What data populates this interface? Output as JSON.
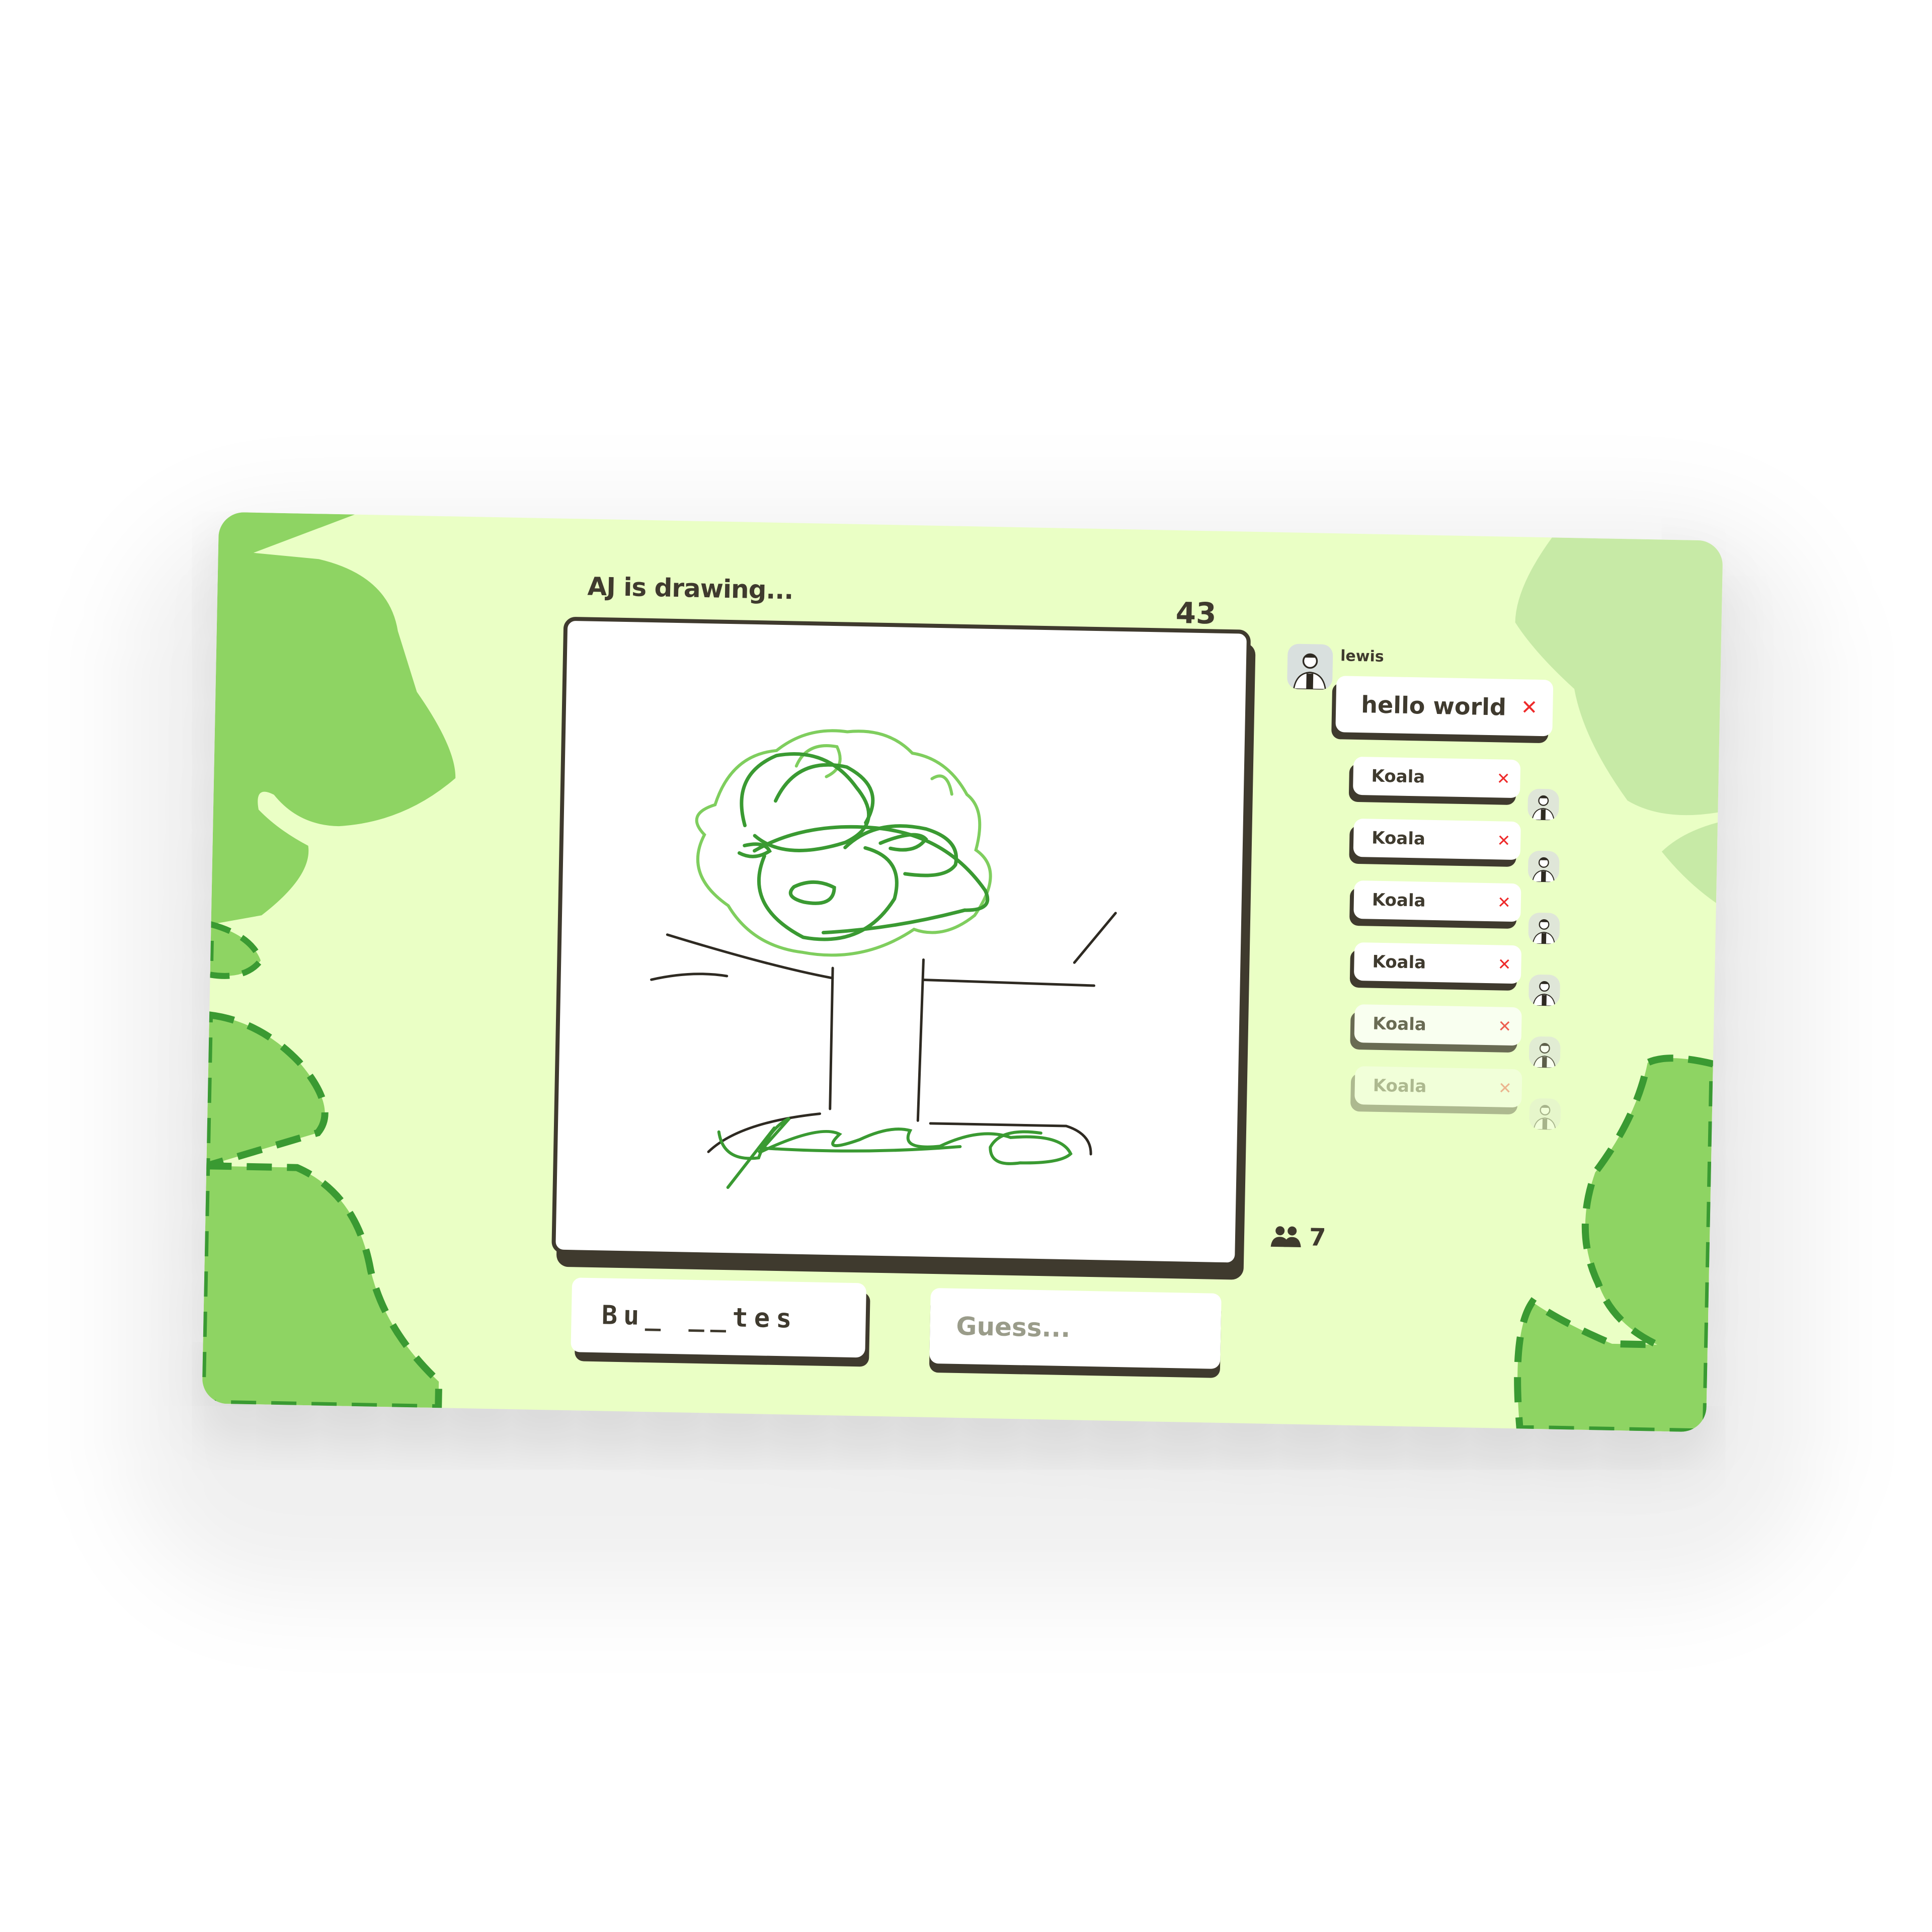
{
  "game": {
    "status_text": "AJ is drawing...",
    "timer": "43",
    "word_hint": "Bu_ __tes",
    "guess_placeholder": "Guess...",
    "player_count": "7"
  },
  "chat": {
    "latest": {
      "username": "lewis",
      "message": "hello world",
      "icon": "close-icon"
    },
    "guesses": [
      {
        "message": "Koala",
        "icon": "close-icon"
      },
      {
        "message": "Koala",
        "icon": "close-icon"
      },
      {
        "message": "Koala",
        "icon": "close-icon"
      },
      {
        "message": "Koala",
        "icon": "close-icon"
      },
      {
        "message": "Koala",
        "icon": "close-icon"
      },
      {
        "message": "Koala",
        "icon": "close-icon"
      }
    ],
    "close_glyph": "✕"
  },
  "colors": {
    "background": "#eaffc5",
    "leaf_dark": "#8ed463",
    "leaf_light": "#c7eaa6",
    "ink": "#3f3a2e",
    "wrong": "#ee2a2a",
    "drawing_green": "#3a9a32"
  }
}
